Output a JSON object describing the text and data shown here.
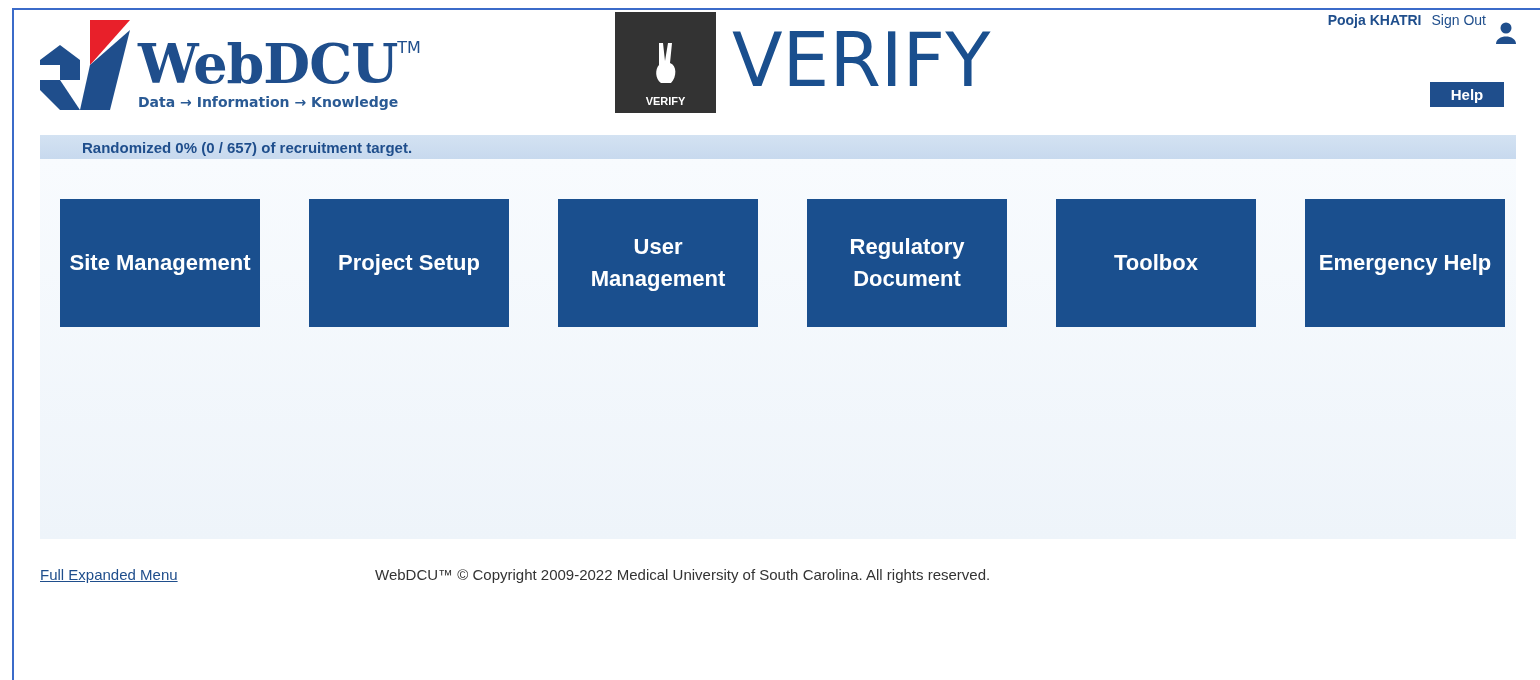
{
  "logo": {
    "name": "WebDCU",
    "trademark": "TM",
    "tagline": "Data → Information → Knowledge"
  },
  "app_badge": {
    "label": "VERIFY"
  },
  "app_title": "VERIFY",
  "user": {
    "name": "Pooja KHATRI",
    "sign_out": "Sign Out"
  },
  "help": "Help",
  "recruitment": "Randomized 0% (0 / 657) of recruitment target.",
  "tiles": [
    {
      "label": "Site Management"
    },
    {
      "label": "Project Setup"
    },
    {
      "label": "User Management"
    },
    {
      "label": "Regulatory Document"
    },
    {
      "label": "Toolbox"
    },
    {
      "label": "Emergency Help"
    }
  ],
  "footer": {
    "menu_link": "Full Expanded Menu",
    "copyright": "WebDCU™  © Copyright 2009-2022 Medical University of South Carolina. All rights reserved."
  }
}
